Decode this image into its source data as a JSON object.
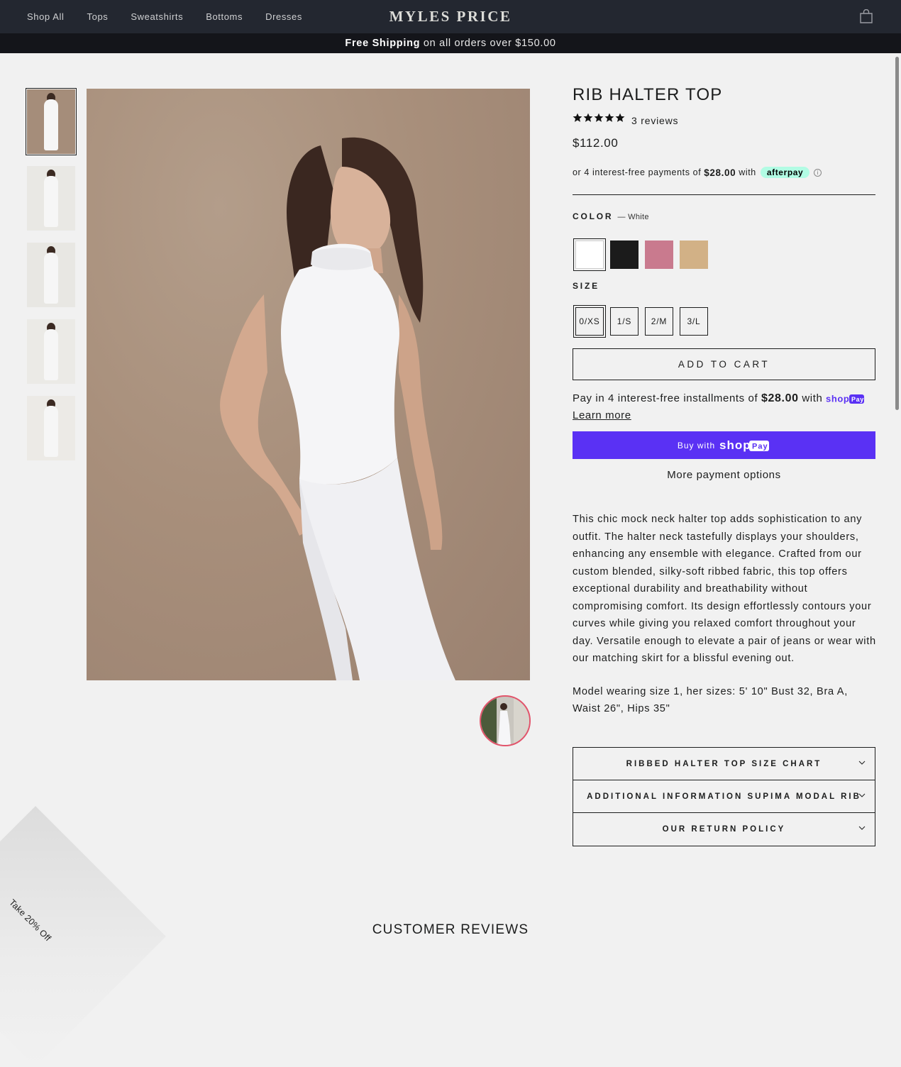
{
  "nav": {
    "links": [
      "Shop All",
      "Tops",
      "Sweatshirts",
      "Bottoms",
      "Dresses"
    ],
    "logo": "MYLES PRICE",
    "cart_icon": "bag-icon"
  },
  "announcement": {
    "bold": "Free Shipping",
    "rest": "on all orders over $150.00"
  },
  "product": {
    "title": "RIB HALTER TOP",
    "rating_stars": 5,
    "review_count": "3 reviews",
    "price": "$112.00",
    "afterpay": {
      "prefix": "or 4 interest-free payments of",
      "amount": "$28.00",
      "suffix": "with",
      "badge": "afterpay"
    },
    "color_label": "COLOR",
    "color_value": "— White",
    "swatches": [
      {
        "name": "White",
        "hex": "#ffffff"
      },
      {
        "name": "Black",
        "hex": "#1b1b1b"
      },
      {
        "name": "Pink",
        "hex": "#c97a8e"
      },
      {
        "name": "Tan",
        "hex": "#d2b186"
      }
    ],
    "size_label": "SIZE",
    "sizes": [
      "0/XS",
      "1/S",
      "2/M",
      "3/L"
    ],
    "selected_size": "0/XS",
    "add_to_cart": "ADD TO CART",
    "shop_installments": {
      "prefix": "Pay in 4 interest-free installments of",
      "amount": "$28.00",
      "suffix": "with",
      "learn_more": "Learn more"
    },
    "buy_with": "Buy with",
    "more_payment": "More payment options",
    "description": "This chic mock neck halter top adds sophistication to any outfit. The halter neck tastefully displays your shoulders, enhancing any ensemble with elegance. Crafted from our custom blended, silky-soft ribbed fabric, this top offers exceptional durability and breathability without compromising comfort. Its design effortlessly contours your curves while giving you relaxed comfort throughout your day. Versatile enough to elevate a pair of jeans or wear with our matching skirt for a blissful evening out.",
    "model_info": "Model wearing size 1, her sizes: 5' 10\" Bust 32, Bra A, Waist 26\", Hips 35\"",
    "accordion": [
      "RIBBED HALTER TOP SIZE CHART",
      "ADDITIONAL INFORMATION SUPIMA MODAL RIB",
      "OUR RETURN POLICY"
    ]
  },
  "thumbnails": [
    {
      "bg": "#a58d7a",
      "active": true
    },
    {
      "bg": "#e9e8e4",
      "active": false
    },
    {
      "bg": "#e8e7e3",
      "active": false
    },
    {
      "bg": "#ebeae6",
      "active": false
    },
    {
      "bg": "#eceae6",
      "active": false
    }
  ],
  "promo": "Take 20% Off",
  "reviews_heading": "CUSTOMER REVIEWS"
}
